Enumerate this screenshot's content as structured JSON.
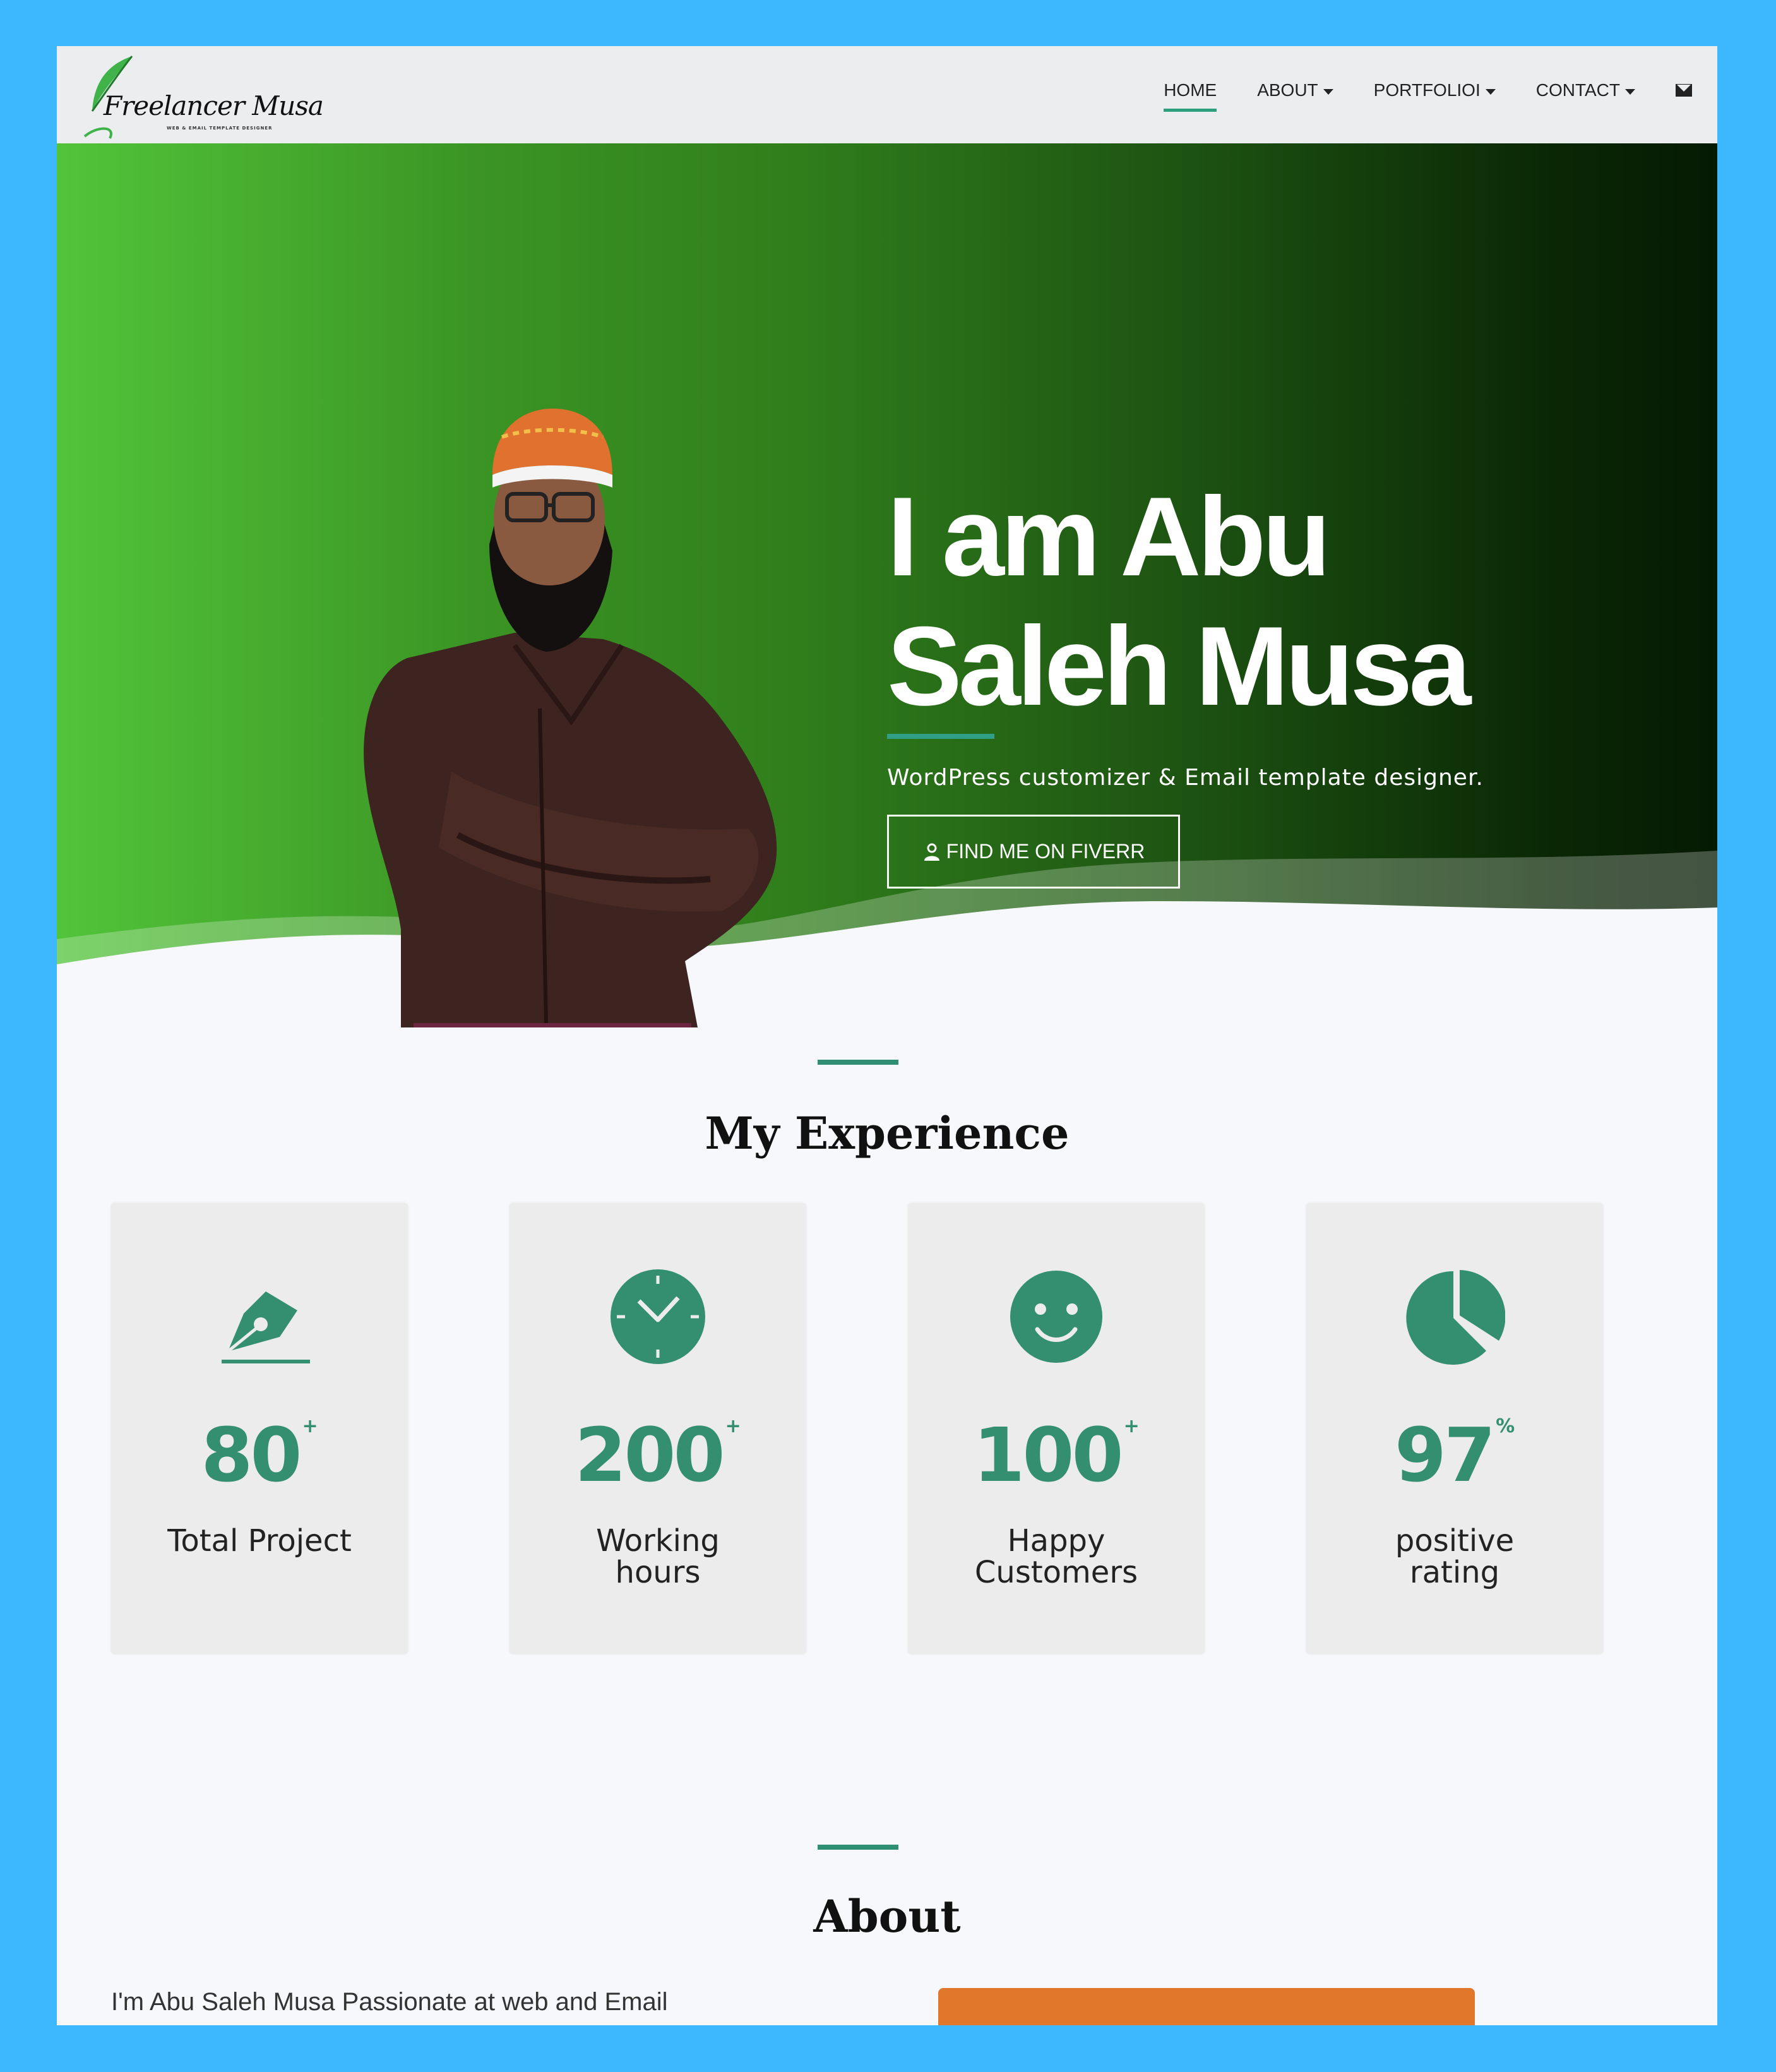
{
  "logo": {
    "text": "Freelancer Musa",
    "tagline": "WEB & EMAIL TEMPLATE DESIGNER"
  },
  "nav": {
    "items": [
      {
        "label": "HOME",
        "active": true,
        "dropdown": false
      },
      {
        "label": "ABOUT",
        "active": false,
        "dropdown": true
      },
      {
        "label": "PORTFOLIOI",
        "active": false,
        "dropdown": true
      },
      {
        "label": "CONTACT",
        "active": false,
        "dropdown": true
      }
    ],
    "mail_icon": "envelope-icon"
  },
  "hero": {
    "title_line1": "I am Abu",
    "title_line2": "Saleh Musa",
    "subtitle": "WordPress customizer & Email template designer.",
    "button_label": "FIND ME ON FIVERR",
    "button_icon": "user-icon"
  },
  "experience": {
    "title": "My Experience",
    "cards": [
      {
        "icon": "pen-nib-icon",
        "value": "80",
        "suffix": "+",
        "label_line1": "Total Project",
        "label_line2": ""
      },
      {
        "icon": "clock-icon",
        "value": "200",
        "suffix": "+",
        "label_line1": "Working",
        "label_line2": "hours"
      },
      {
        "icon": "smiley-icon",
        "value": "100",
        "suffix": "+",
        "label_line1": "Happy",
        "label_line2": "Customers"
      },
      {
        "icon": "pie-chart-icon",
        "value": "97",
        "suffix": "%",
        "label_line1": "positive",
        "label_line2": "rating"
      }
    ]
  },
  "about": {
    "title": "About",
    "intro": "I'm Abu Saleh Musa Passionate at web and Email"
  },
  "colors": {
    "accent": "#2e8f73",
    "hero_start": "#52c43a",
    "hero_end": "#051a03",
    "frame": "#3db8ff"
  }
}
